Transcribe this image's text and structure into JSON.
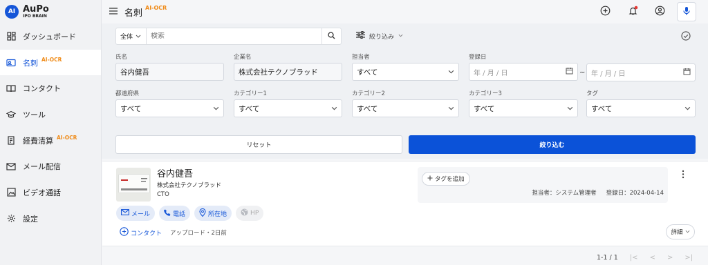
{
  "app": {
    "logo_badge": "AI",
    "logo_name": "AuPo",
    "logo_sub": "IPO BRAIN"
  },
  "sidebar": {
    "items": [
      {
        "label": "ダッシュボード",
        "icon": "dashboard-icon"
      },
      {
        "label": "名刺",
        "badge": "AI-OCR",
        "icon": "business-card-icon",
        "active": true
      },
      {
        "label": "コンタクト",
        "icon": "book-icon"
      },
      {
        "label": "ツール",
        "icon": "graduation-cap-icon"
      },
      {
        "label": "経費清算",
        "badge": "AI-OCR",
        "icon": "receipt-icon"
      },
      {
        "label": "メール配信",
        "icon": "mail-icon"
      },
      {
        "label": "ビデオ通話",
        "icon": "image-icon"
      },
      {
        "label": "設定",
        "icon": "gear-icon"
      }
    ]
  },
  "header": {
    "title": "名刺",
    "badge": "AI-OCR"
  },
  "search": {
    "scope": "全体",
    "placeholder": "検索",
    "filter_label": "絞り込み"
  },
  "filters": {
    "name": {
      "label": "氏名",
      "value": "谷内健吾"
    },
    "company": {
      "label": "企業名",
      "value": "株式会社テクノブラッド"
    },
    "owner": {
      "label": "担当者",
      "value": "すべて"
    },
    "date": {
      "label": "登録日",
      "from": "年 / 月 / 日",
      "to": "年 / 月 / 日",
      "sep": "~"
    },
    "prefecture": {
      "label": "都道府県",
      "value": "すべて"
    },
    "cat1": {
      "label": "カテゴリー1",
      "value": "すべて"
    },
    "cat2": {
      "label": "カテゴリー2",
      "value": "すべて"
    },
    "cat3": {
      "label": "カテゴリー3",
      "value": "すべて"
    },
    "tag": {
      "label": "タグ",
      "value": "すべて"
    },
    "reset": "リセット",
    "apply": "絞り込む"
  },
  "card": {
    "name": "谷内健吾",
    "company": "株式会社テクノブラッド",
    "title": "CTO",
    "actions": {
      "mail": "メール",
      "phone": "電話",
      "location": "所在地",
      "hp": "HP"
    },
    "contact": "コンタクト",
    "uploaded": "アップロード・2日前",
    "add_tag": "タグを追加",
    "owner": "担当者：システム管理者",
    "registered": "登録日：2024-04-14",
    "details": "詳細"
  },
  "pagination": {
    "range": "1-1 / 1"
  },
  "colors": {
    "accent": "#0b52d8",
    "ocr": "#f08c1a"
  }
}
